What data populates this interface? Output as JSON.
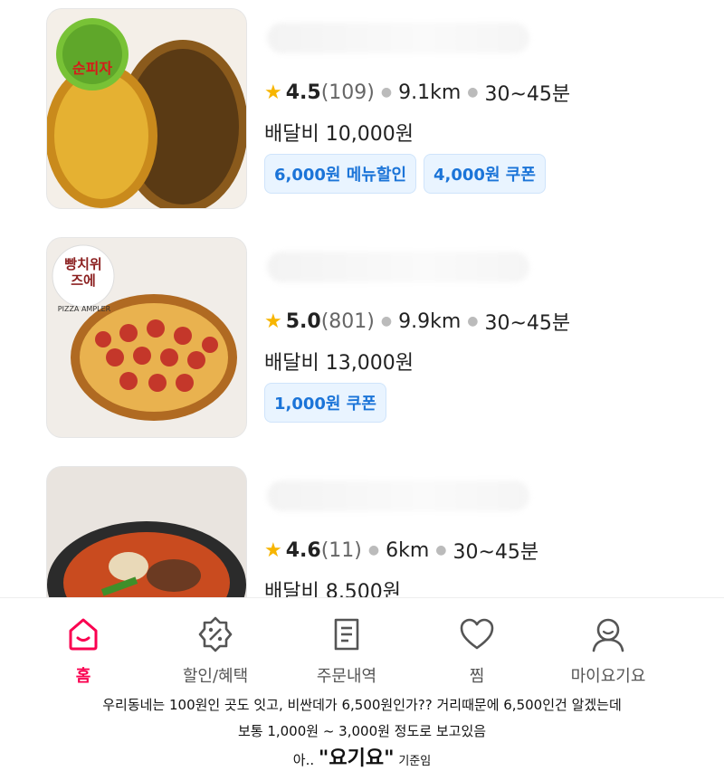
{
  "items": [
    {
      "thumb_label": "피자",
      "logo_text": "순피자",
      "rating": "4.5",
      "review_count": "(109)",
      "distance": "9.1km",
      "time": "30~45분",
      "delivery_fee": "배달비 10,000원",
      "badges": [
        "6,000원 메뉴할인",
        "4,000원 쿠폰"
      ]
    },
    {
      "thumb_label": "페퍼로니 피자",
      "logo_text": "빵치위즈에",
      "logo_sub": "PIZZA AMPLER",
      "rating": "5.0",
      "review_count": "(801)",
      "distance": "9.9km",
      "time": "30~45분",
      "delivery_fee": "배달비 13,000원",
      "badges": [
        "1,000원 쿠폰"
      ]
    },
    {
      "thumb_label": "찌개",
      "rating": "4.6",
      "review_count": "(11)",
      "distance": "6km",
      "time": "30~45분",
      "delivery_fee": "배달비 8,500원",
      "badges": []
    }
  ],
  "nav": {
    "items": [
      {
        "label": "홈",
        "icon": "home-icon",
        "active": true
      },
      {
        "label": "할인/혜택",
        "icon": "discount-icon",
        "active": false
      },
      {
        "label": "주문내역",
        "icon": "receipt-icon",
        "active": false
      },
      {
        "label": "찜",
        "icon": "heart-icon",
        "active": false
      },
      {
        "label": "마이요기요",
        "icon": "profile-icon",
        "active": false
      }
    ]
  },
  "caption": {
    "line1": "우리동네는 100원인 곳도 잇고, 비싼데가 6,500원인가?? 거리때문에 6,500인건 알겠는데",
    "line2": "보통 1,000원 ~ 3,000원 정도로 보고있음",
    "line3_prefix": "아..",
    "line3_brand": "\"요기요\"",
    "line3_suffix": "기준임"
  },
  "colors": {
    "accent": "#fa0050",
    "coupon_text": "#1b74d8",
    "coupon_bg": "#e9f4ff",
    "star": "#f7b500"
  }
}
